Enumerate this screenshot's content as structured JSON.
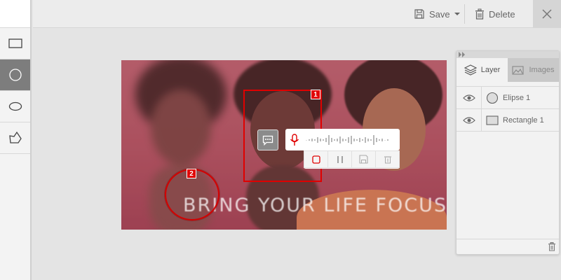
{
  "toolbar": {
    "save_label": "Save",
    "delete_label": "Delete"
  },
  "tools": [
    "rectangle-tool",
    "circle-tool",
    "ellipse-tool",
    "polygon-tool"
  ],
  "canvas": {
    "caption": "BRING YOUR LIFE FOCUS"
  },
  "annotations": {
    "rect_badge": "1",
    "ellipse_badge": "2"
  },
  "layers_panel": {
    "tab_layer": "Layer",
    "tab_images": "Images",
    "items": [
      {
        "name": "Elipse 1",
        "shape": "circle"
      },
      {
        "name": "Rectangle 1",
        "shape": "rectangle"
      }
    ]
  },
  "colors": {
    "accent": "#e00000",
    "active_tool": "#7d7d7d"
  }
}
